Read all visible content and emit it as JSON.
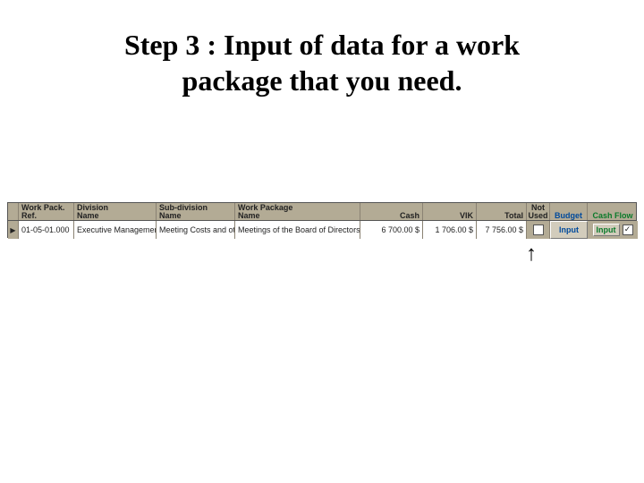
{
  "title_line1": "Step 3 : Input of data for a work",
  "title_line2": "package that you need.",
  "headers": {
    "ref_l1": "Work Pack.",
    "ref_l2": "Ref.",
    "div_l1": "Division",
    "div_l2": "Name",
    "sub_l1": "Sub-division",
    "sub_l2": "Name",
    "wp_l1": "Work Package",
    "wp_l2": "Name",
    "cash": "Cash",
    "vik": "VIK",
    "total": "Total",
    "not_l1": "Not",
    "not_l2": "Used",
    "budget": "Budget",
    "cashflow": "Cash Flow"
  },
  "row": {
    "ref": "01-05-01.000",
    "division": "Executive Managemen",
    "subdivision": "Meeting Costs and ot",
    "workpackage": "Meetings of the Board of Directors",
    "cash": "6 700.00 $",
    "vik": "1 706.00 $",
    "total": "7 756.00 $",
    "not_used_checked": false,
    "budget_button": "Input",
    "cashflow_button": "Input",
    "cashflow_checked": true,
    "pointer": "▶"
  },
  "arrow_glyph": "↑"
}
